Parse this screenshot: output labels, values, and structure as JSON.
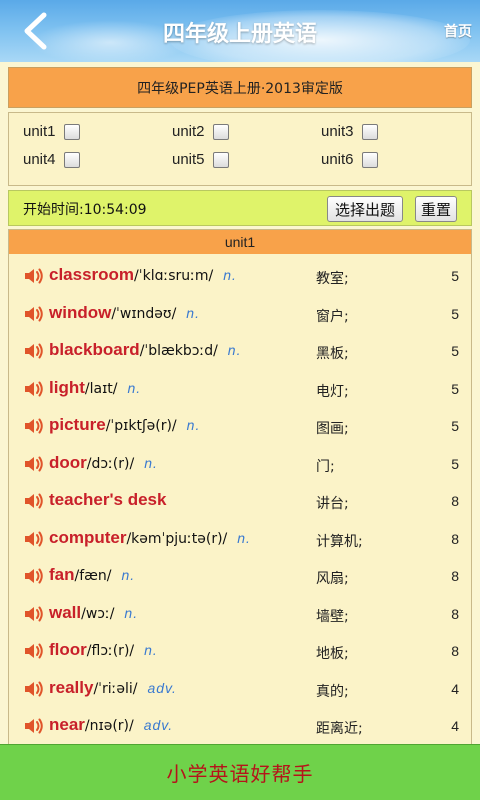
{
  "header": {
    "title": "四年级上册英语",
    "home_label": "首页"
  },
  "book": {
    "label": "四年级PEP英语上册·2013审定版"
  },
  "units": [
    {
      "label": "unit1",
      "checked": false
    },
    {
      "label": "unit2",
      "checked": false
    },
    {
      "label": "unit3",
      "checked": false
    },
    {
      "label": "unit4",
      "checked": false
    },
    {
      "label": "unit5",
      "checked": false
    },
    {
      "label": "unit6",
      "checked": false
    }
  ],
  "timer": {
    "text": "开始时间:10:54:09",
    "select_label": "选择出题",
    "reset_label": "重置"
  },
  "list": {
    "section_title": "unit1",
    "words": [
      {
        "word": "classroom",
        "phonetic": "/ˈklɑːsruːm/",
        "pos": "n.",
        "meaning": "教室;",
        "count": "5"
      },
      {
        "word": "window",
        "phonetic": "/ˈwɪndəʊ/",
        "pos": "n.",
        "meaning": "窗户;",
        "count": "5"
      },
      {
        "word": "blackboard",
        "phonetic": "/ˈblækbɔːd/",
        "pos": "n.",
        "meaning": "黑板;",
        "count": "5"
      },
      {
        "word": "light",
        "phonetic": "/laɪt/",
        "pos": "n.",
        "meaning": "电灯;",
        "count": "5"
      },
      {
        "word": "picture",
        "phonetic": "/ˈpɪktʃə(r)/",
        "pos": "n.",
        "meaning": "图画;",
        "count": "5"
      },
      {
        "word": "door",
        "phonetic": "/dɔː(r)/",
        "pos": "n.",
        "meaning": "门;",
        "count": "5"
      },
      {
        "word": "teacher's desk",
        "phonetic": "",
        "pos": "",
        "meaning": "讲台;",
        "count": "8"
      },
      {
        "word": "computer",
        "phonetic": "/kəmˈpjuːtə(r)/",
        "pos": "n.",
        "meaning": "计算机;",
        "count": "8"
      },
      {
        "word": "fan",
        "phonetic": "/fæn/",
        "pos": "n.",
        "meaning": "风扇;",
        "count": "8"
      },
      {
        "word": "wall",
        "phonetic": "/wɔː/",
        "pos": "n.",
        "meaning": "墙壁;",
        "count": "8"
      },
      {
        "word": "floor",
        "phonetic": "/flɔː(r)/",
        "pos": "n.",
        "meaning": "地板;",
        "count": "8"
      },
      {
        "word": "really",
        "phonetic": "/ˈriːəli/",
        "pos": "adv.",
        "meaning": "真的;",
        "count": "4"
      },
      {
        "word": "near",
        "phonetic": "/nɪə(r)/",
        "pos": "adv.",
        "meaning": "距离近;",
        "count": "4"
      }
    ]
  },
  "footer": {
    "text": "小学英语好帮手"
  },
  "colors": {
    "accent_orange": "#f8a24a",
    "word_red": "#c8202a",
    "pos_blue": "#3a7ad0",
    "footer_green": "#6fd24a",
    "timer_lime": "#dff36a"
  },
  "icons": {
    "back": "chevron-left-icon",
    "speaker": "speaker-icon"
  }
}
